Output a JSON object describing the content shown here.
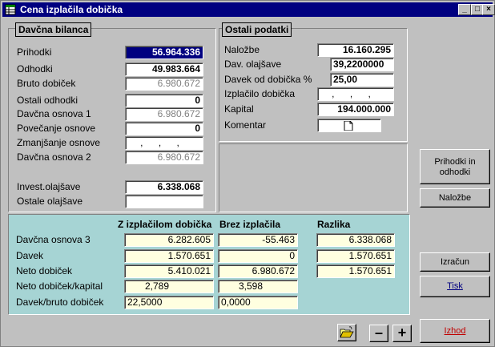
{
  "window": {
    "title": "Cena izplačila dobička",
    "min": "_",
    "max": "□",
    "close": "×"
  },
  "left_panel": {
    "title": "Davčna bilanca",
    "rows": [
      {
        "label": "Prihodki",
        "value": "56.964.336"
      },
      {
        "label": "Odhodki",
        "value": "49.983.664"
      },
      {
        "label": "Bruto dobiček",
        "value": "6.980.672"
      },
      {
        "label": "Ostali odhodki",
        "value": "0"
      },
      {
        "label": "Davčna osnova 1",
        "value": "6.980.672"
      },
      {
        "label": "Povečanje osnove",
        "value": "0"
      },
      {
        "label": "Zmanjšanje osnove",
        "value": ", , ,"
      },
      {
        "label": "Davčna osnova 2",
        "value": "6.980.672"
      },
      {
        "label": "Invest.olajšave",
        "value": "6.338.068"
      },
      {
        "label": "Ostale olajšave",
        "value": ""
      }
    ]
  },
  "right_panel": {
    "title": "Ostali podatki",
    "rows": [
      {
        "label": "Naložbe",
        "value": "16.160.295"
      },
      {
        "label": "Dav. olajšave",
        "value": "39,2200000"
      },
      {
        "label": "Davek od dobička %",
        "value": "25,00"
      },
      {
        "label": "Izplačilo dobička",
        "value": ", , ,"
      },
      {
        "label": "Kapital",
        "value": "194.000.000"
      },
      {
        "label": "Komentar",
        "value": ""
      }
    ]
  },
  "results": {
    "headers": [
      "Z izplačilom dobička",
      "Brez izplačila",
      "Razlika"
    ],
    "rows": [
      {
        "label": "Davčna osnova 3",
        "a": "6.282.605",
        "b": "-55.463",
        "c": "6.338.068"
      },
      {
        "label": "Davek",
        "a": "1.570.651",
        "b": "0",
        "c": "1.570.651"
      },
      {
        "label": "Neto dobiček",
        "a": "5.410.021",
        "b": "6.980.672",
        "c": "1.570.651"
      },
      {
        "label": "Neto dobiček/kapital",
        "a": "2,789",
        "b": "3,598",
        "c": ""
      },
      {
        "label": "Davek/bruto dobiček",
        "a": "22,5000",
        "b": "0,0000",
        "c": ""
      }
    ]
  },
  "buttons": {
    "prihodki_odhodki": "Prihodki in odhodki",
    "nalozbe": "Naložbe",
    "izracun": "Izračun",
    "tisk": "Tisk",
    "izhod": "Izhod",
    "minus": "–",
    "plus": "+"
  },
  "colors": {
    "title_bar": "#000080",
    "results_bg": "#a6d4d4",
    "selected_field": "#000080"
  }
}
